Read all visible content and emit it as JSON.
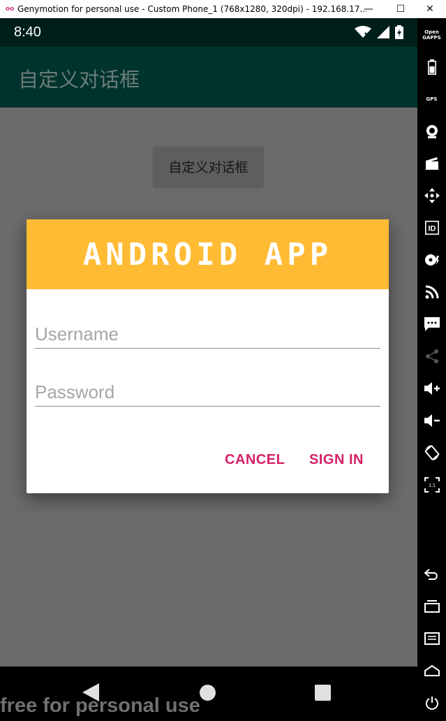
{
  "window": {
    "logo_glyph": "oo",
    "title": "Genymotion for personal use - Custom Phone_1 (768x1280, 320dpi) - 192.168.17...",
    "minimize_glyph": "—",
    "maximize_glyph": "☐",
    "close_glyph": "✕"
  },
  "statusbar": {
    "time": "8:40",
    "icons": [
      "wifi-icon",
      "signal-icon",
      "battery-icon"
    ]
  },
  "app": {
    "title": "自定义对话框",
    "button_label": "自定义对话框"
  },
  "dialog": {
    "header_text": "ANDROID APP",
    "header_color": "#ffbb33",
    "username_placeholder": "Username",
    "username_value": "",
    "password_placeholder": "Password",
    "password_value": "",
    "cancel_label": "CANCEL",
    "signin_label": "SIGN IN",
    "accent_color": "#d62066"
  },
  "navbar": {
    "buttons": [
      "back-icon",
      "home-icon",
      "recents-icon"
    ]
  },
  "watermark": "free for personal use",
  "sidebar": {
    "items": [
      {
        "name": "open-gapps-icon",
        "label": "Open GAPPS"
      },
      {
        "name": "battery-icon",
        "label": ""
      },
      {
        "name": "gps-icon",
        "label": "GPS"
      },
      {
        "name": "webcam-icon",
        "label": ""
      },
      {
        "name": "screencast-icon",
        "label": ""
      },
      {
        "name": "dpad-icon",
        "label": ""
      },
      {
        "name": "identifiers-icon",
        "label": "ID"
      },
      {
        "name": "disk-io-icon",
        "label": ""
      },
      {
        "name": "network-icon",
        "label": ""
      },
      {
        "name": "sms-icon",
        "label": ""
      },
      {
        "name": "share-icon",
        "label": ""
      },
      {
        "name": "volume-up-icon",
        "label": ""
      },
      {
        "name": "volume-down-icon",
        "label": ""
      },
      {
        "name": "rotate-icon",
        "label": ""
      },
      {
        "name": "pixel-perfect-icon",
        "label": "1:1"
      },
      {
        "name": "back-icon",
        "label": ""
      },
      {
        "name": "recent-apps-icon",
        "label": ""
      },
      {
        "name": "menu-icon",
        "label": ""
      },
      {
        "name": "home-icon",
        "label": ""
      },
      {
        "name": "power-icon",
        "label": ""
      }
    ]
  }
}
